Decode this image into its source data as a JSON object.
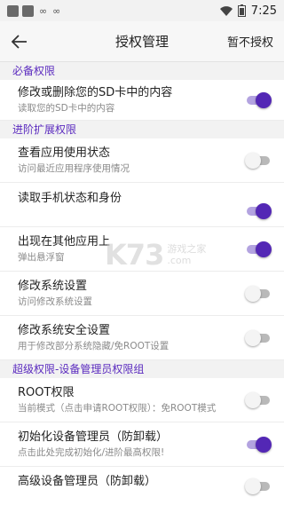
{
  "status_bar": {
    "time": "7:25",
    "icons": [
      "app-icon-1",
      "app-icon-2",
      "vpn-icon",
      "vpn-icon",
      "wifi-icon",
      "battery-icon"
    ]
  },
  "app_bar": {
    "title": "授权管理",
    "action_label": "暂不授权",
    "back_icon": "arrow-left-icon"
  },
  "sections": [
    {
      "label": "必备权限",
      "items": [
        {
          "title": "修改或删除您的SD卡中的内容",
          "subtitle": "读取您的SD卡中的内容",
          "enabled": true
        }
      ]
    },
    {
      "label": "进阶扩展权限",
      "items": [
        {
          "title": "查看应用使用状态",
          "subtitle": "访问最近应用程序使用情况",
          "enabled": false
        },
        {
          "title": "读取手机状态和身份",
          "subtitle": "",
          "enabled": true
        },
        {
          "title": "出现在其他应用上",
          "subtitle": "弹出悬浮窗",
          "enabled": true
        },
        {
          "title": "修改系统设置",
          "subtitle": "访问修改系统设置",
          "enabled": false
        },
        {
          "title": "修改系统安全设置",
          "subtitle": "用于修改部分系统隐藏/免ROOT设置",
          "enabled": false
        }
      ]
    },
    {
      "label": "超级权限-设备管理员权限组",
      "items": [
        {
          "title": "ROOT权限",
          "subtitle": "当前模式（点击申请ROOT权限）：免ROOT模式",
          "enabled": false
        },
        {
          "title": "初始化设备管理员（防卸载）",
          "subtitle": "点击此处完成初始化/进阶最高权限!",
          "enabled": true
        },
        {
          "title": "高级设备管理员（防卸载）",
          "subtitle": "",
          "enabled": false
        }
      ]
    }
  ],
  "watermark": {
    "logo": "K73",
    "line1": "游戏之家",
    "line2": ".com"
  },
  "colors": {
    "accent": "#5327b5",
    "section_text": "#5b2bbf",
    "toggle_off_track": "#b9b9b9"
  }
}
